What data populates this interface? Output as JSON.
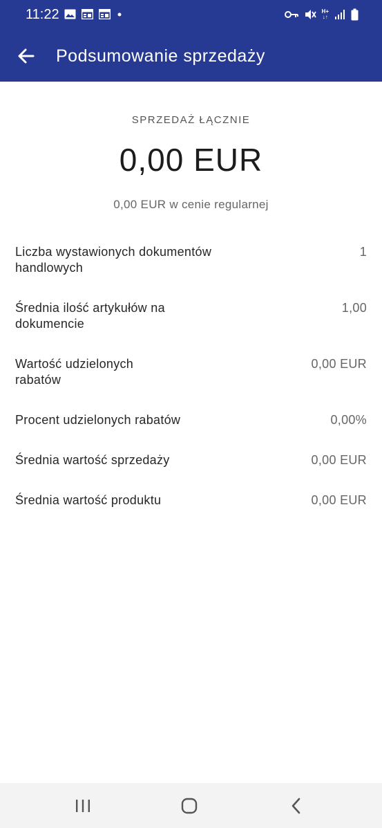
{
  "status_bar": {
    "time": "11:22",
    "left_icons": [
      "image-icon",
      "calendar-icon",
      "calendar-icon",
      "dot-icon"
    ],
    "right_icons": [
      "vpn-key-icon",
      "mute-icon",
      "network-type-icon",
      "signal-icon",
      "battery-icon"
    ],
    "network_label_top": "H+",
    "network_label_bottom": "↓↑"
  },
  "app_bar": {
    "title": "Podsumowanie sprzedaży",
    "background": "#273a93"
  },
  "summary": {
    "total_label": "SPRZEDAŻ ŁĄCZNIE",
    "total_value": "0,00 EUR",
    "regular_price": "0,00 EUR w cenie regularnej"
  },
  "stats": [
    {
      "label_line1": "Liczba wystawionych dokumentów",
      "label_line2": "handlowych",
      "value": "1"
    },
    {
      "label_line1": "Średnia ilość artykułów na",
      "label_line2": "dokumencie",
      "value": "1,00"
    },
    {
      "label_line1": "Wartość udzielonych",
      "label_line2": "rabatów",
      "value": "0,00 EUR"
    },
    {
      "label_line1": "Procent udzielonych rabatów",
      "label_line2": "",
      "value": "0,00%"
    },
    {
      "label_line1": "Średnia wartość sprzedaży",
      "label_line2": "",
      "value": "0,00 EUR"
    },
    {
      "label_line1": "Średnia wartość produktu",
      "label_line2": "",
      "value": "0,00 EUR"
    }
  ],
  "nav_bar": {
    "buttons": [
      "recent-apps-icon",
      "home-icon",
      "back-icon"
    ]
  }
}
